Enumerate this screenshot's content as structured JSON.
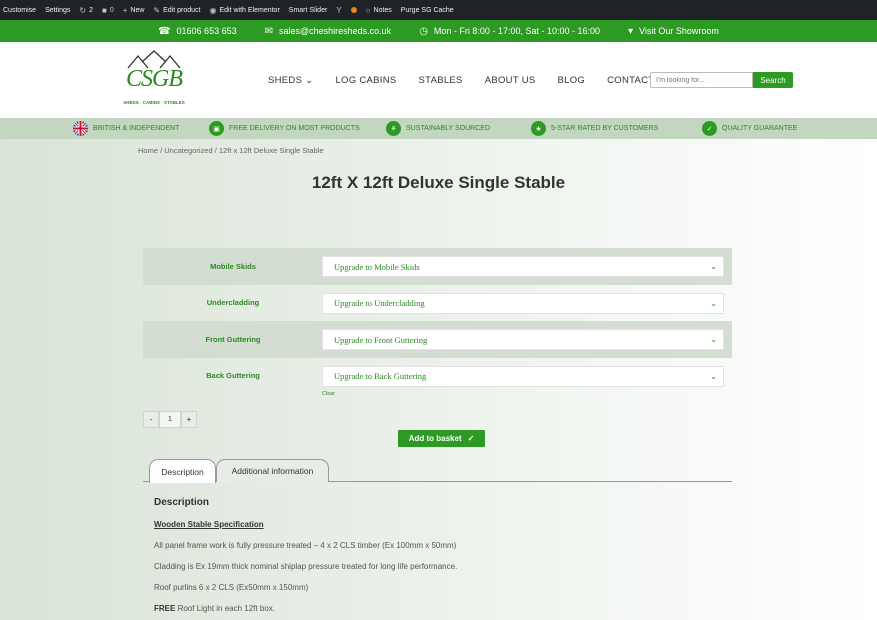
{
  "admin_bar": {
    "customise": "Customise",
    "settings": "Settings",
    "updates_count": "2",
    "comments_count": "0",
    "new": "New",
    "edit_product": "Edit product",
    "edit_elementor": "Edit with Elementor",
    "smart_slider": "Smart Slider",
    "notes": "Notes",
    "purge": "Purge SG Cache"
  },
  "topbar": {
    "phone": "01606 653 653",
    "email": "sales@cheshiresheds.co.uk",
    "hours": "Mon - Fri 8:00 - 17:00, Sat - 10:00 - 16:00",
    "showroom": "Visit Our Showroom"
  },
  "logo": {
    "text": "CSGB",
    "tagline": "SHEDS · CABINS · STABLES",
    "group": "group"
  },
  "nav": {
    "items": [
      "SHEDS",
      "LOG CABINS",
      "STABLES",
      "ABOUT US",
      "BLOG",
      "CONTACT"
    ]
  },
  "search": {
    "placeholder": "I'm looking for...",
    "button": "Search"
  },
  "features": [
    "BRITISH & INDEPENDENT",
    "FREE DELIVERY ON MOST PRODUCTS",
    "SUSTAINABLY SOURCED",
    "5-STAR RATED BY CUSTOMERS",
    "QUALITY GUARANTEE"
  ],
  "breadcrumb": "Home / Uncategorized / 12ft x 12ft Deluxe Single Stable",
  "product": {
    "title": "12ft X 12ft Deluxe Single Stable",
    "variations": [
      {
        "label": "Mobile Skids",
        "value": "Upgrade to Mobile Skids"
      },
      {
        "label": "Undercladding",
        "value": "Upgrade to Undercladding"
      },
      {
        "label": "Front Guttering",
        "value": "Upgrade to Front Guttering"
      },
      {
        "label": "Back Guttering",
        "value": "Upgrade to Back Guttering"
      }
    ],
    "clear": "Clear",
    "qty_minus": "-",
    "qty_value": "1",
    "qty_plus": "+",
    "add_to_basket": "Add to basket"
  },
  "tabs": [
    "Description",
    "Additional information"
  ],
  "description": {
    "heading": "Description",
    "subheading": "Wooden Stable Specification",
    "lines": [
      "All panel frame work is fully pressure treated – 4 x 2 CLS timber (Ex 100mm x 50mm)",
      "Cladding is Ex 19mm thick nominal shiplap pressure treated for long life performance.",
      "Roof purlins 6 x 2 CLS (Ex50mm x 150mm)"
    ],
    "last_bold": "FREE",
    "last_rest": " Roof Light in each 12ft box."
  },
  "colors": {
    "brand_green": "#2c9a23",
    "admin_bar": "#1d2327",
    "feature_bar": "#c2d6c0"
  }
}
